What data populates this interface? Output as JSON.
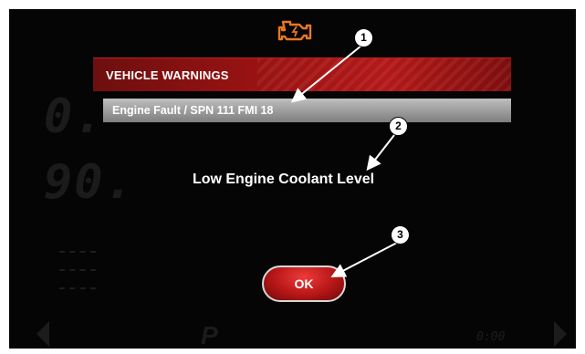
{
  "icons": {
    "engine": "check-engine-icon",
    "accent_color": "#e87722"
  },
  "dialog": {
    "title": "VEHICLE WARNINGS",
    "fault_code": "Engine Fault / SPN 111 FMI 18",
    "message": "Low Engine Coolant Level",
    "ok_label": "OK",
    "header_color": "#a51414",
    "button_color": "#c41a1a"
  },
  "callouts": [
    "1",
    "2",
    "3"
  ],
  "background": {
    "speed_digits": "0.",
    "rpm_digits": "90.",
    "time": "0:00",
    "gear": "P"
  }
}
